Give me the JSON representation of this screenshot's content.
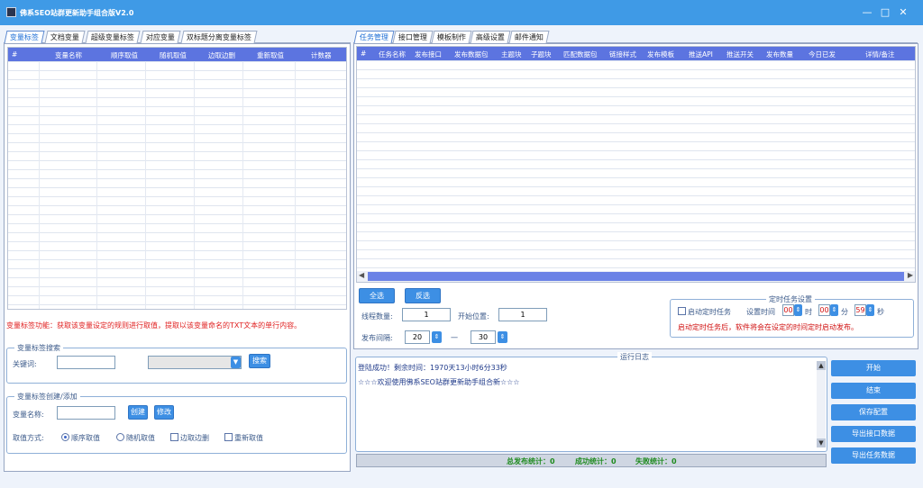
{
  "window": {
    "title": "佛系SEO站群更新助手组合版V2.0"
  },
  "left_tabs": [
    "变量标签",
    "文档变量",
    "超级变量标签",
    "对应变量",
    "双标题分离变量标签"
  ],
  "right_tabs": [
    "任务管理",
    "接口管理",
    "模板制作",
    "高级设置",
    "邮件通知"
  ],
  "var_table": {
    "columns": [
      "#",
      "变量名称",
      "顺序取值",
      "随机取值",
      "边取边删",
      "重新取值",
      "计数器"
    ]
  },
  "var_hint": "变量标签功能：获取该变量设定的规则进行取值，提取以该变量命名的TXT文本的单行内容。",
  "search_box": {
    "legend": "变量标签搜索",
    "keyword_label": "关键词:",
    "keyword_value": "",
    "select_value": "",
    "search_button": "搜索"
  },
  "create_box": {
    "legend": "变量标签创建/添加",
    "name_label": "变量名称:",
    "name_value": "",
    "create_button": "创建",
    "modify_button": "修改",
    "mode_label": "取值方式:",
    "options": [
      "顺序取值",
      "随机取值",
      "边取边删",
      "重新取值"
    ]
  },
  "task_table": {
    "columns": [
      "#",
      "任务名称",
      "发布接口",
      "发布数据包",
      "主题块",
      "子题块",
      "匹配数据包",
      "链接样式",
      "发布模板",
      "推送API",
      "推送开关",
      "发布数量",
      "今日已发",
      "详情/备注"
    ]
  },
  "task_controls": {
    "select_all": "全选",
    "invert": "反选",
    "threads_label": "线程数量:",
    "threads_value": "1",
    "start_pos_label": "开始位置:",
    "start_pos_value": "1",
    "interval_label": "发布间隔:",
    "interval_from": "20",
    "dash": "一",
    "interval_to": "30"
  },
  "schedule": {
    "legend": "定时任务设置",
    "enable_label": "启动定时任务",
    "time_label": "设置时间",
    "hour": "00",
    "hour_unit": "时",
    "minute": "00",
    "minute_unit": "分",
    "second": "59",
    "second_unit": "秒",
    "note": "启动定时任务后，软件将会在设定的时间定时启动发布。"
  },
  "log": {
    "legend": "运行日志",
    "lines": [
      "登陆成功！剩余时间：1970天13小时6分33秒",
      "☆☆☆欢迎使用佛系SEO站群更新助手组合新☆☆☆"
    ]
  },
  "status": {
    "total": "总发布统计：0",
    "success": "成功统计：0",
    "fail": "失败统计：0"
  },
  "side_buttons": [
    "开始",
    "结束",
    "保存配置",
    "导出接口数据",
    "导出任务数据"
  ],
  "colors": {
    "titlebar": "#3f9ae6",
    "grid_header": "#5c74e0",
    "button": "#3d8fe4",
    "hint": "#e02020",
    "stats": "#1e8a1e"
  }
}
